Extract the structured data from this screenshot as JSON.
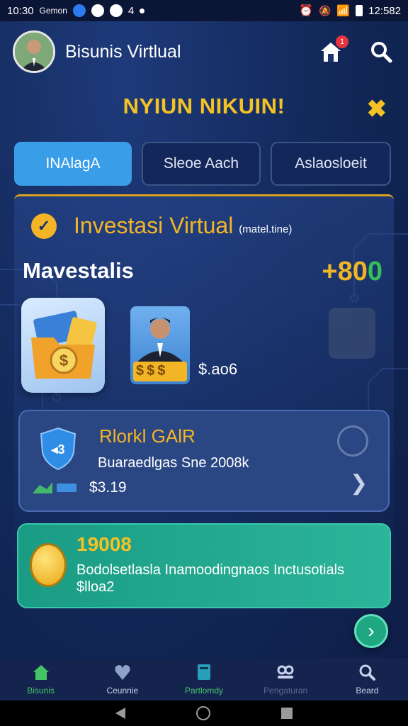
{
  "status_bar": {
    "time_left": "10:30",
    "carrier": "Gemon",
    "icon_a": "4",
    "time_right": "12:582"
  },
  "header": {
    "title": "Bisunis Virtlual",
    "notification_count": "1"
  },
  "title_bar": {
    "title": "NYIUN NIKUIN!",
    "close_symbol": "✖"
  },
  "tabs": [
    {
      "label": "INAlagA",
      "active": true
    },
    {
      "label": "Sleoe Aach",
      "active": false
    },
    {
      "label": "Aslaosloeit",
      "active": false
    }
  ],
  "investasi": {
    "title": "Investasi Virtual",
    "subtitle": "(matel.tine)",
    "label": "Mavestalis",
    "amount_prefix": "+80",
    "amount_suffix": "0",
    "person_price": "$.ao6",
    "person_coins": "$$$"
  },
  "risk_card": {
    "title": "Rlorkl GAlR",
    "subtitle": "Buaraedlgas Sne 2008k",
    "value": "$3.19"
  },
  "green_card": {
    "amount": "19008",
    "text": "Bodolsetlasla Inamoodingnaos Inctusotials $lloa2"
  },
  "bottom_nav": [
    {
      "label": "Bisunis",
      "icon": "home-icon",
      "active": true
    },
    {
      "label": "Ceunnie",
      "icon": "heart-icon",
      "active": false
    },
    {
      "label": "Partlomdy",
      "icon": "book-icon",
      "active": false
    },
    {
      "label": "Pengaturan",
      "icon": "people-icon",
      "active": false
    },
    {
      "label": "Beard",
      "icon": "search-icon",
      "active": false
    }
  ],
  "colors": {
    "accent_gold": "#f2b526",
    "accent_blue": "#3a9de8",
    "accent_green": "#1fa782",
    "background": "#10204d"
  }
}
